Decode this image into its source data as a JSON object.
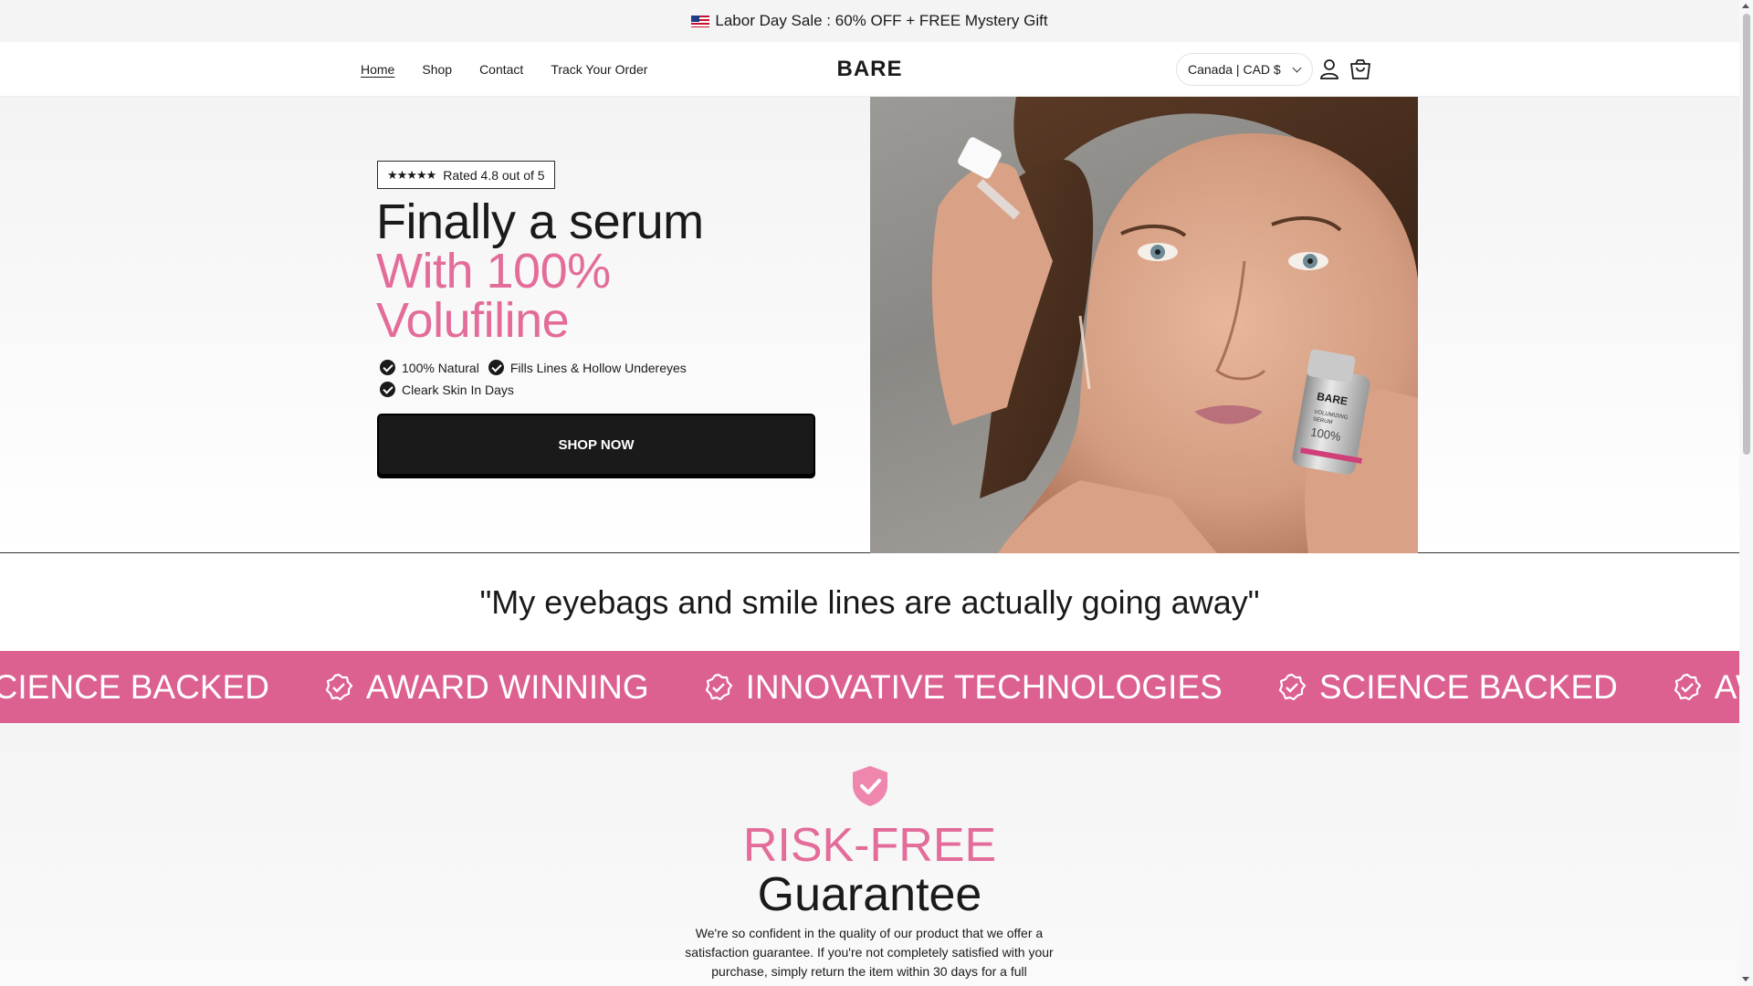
{
  "announcement": {
    "text": "Labor Day Sale : 60% OFF + FREE Mystery Gift"
  },
  "nav": {
    "items": [
      "Home",
      "Shop",
      "Contact",
      "Track Your Order"
    ],
    "active": "Home"
  },
  "brand": {
    "logo": "BARE"
  },
  "header": {
    "currency": "Canada | CAD $",
    "account_icon": "user-icon",
    "cart_icon": "cart-icon"
  },
  "hero": {
    "rating_stars": "★★★★★",
    "rating_text": "Rated 4.8 out of 5",
    "headline_line1": "Finally a serum",
    "headline_line2": "With 100%",
    "headline_line3": "Volufiline",
    "benefits": [
      "100% Natural",
      "Fills Lines & Hollow Undereyes",
      "Cleark Skin In Days"
    ],
    "cta": "SHOP NOW",
    "product_label_brand": "BARE",
    "product_label_line1": "VOLUMIZING",
    "product_label_line2": "SERUM",
    "product_label_pct": "100%",
    "image_alt": "woman-applying-serum-photo"
  },
  "quote": {
    "text": "\"My eyebags and smile lines are actually going away\""
  },
  "marquee": {
    "items": [
      "SCIENCE BACKED",
      "AWARD WINNING",
      "INNOVATIVE TECHNOLOGIES",
      "SCIENCE BACKED",
      "AWARD WINNING"
    ]
  },
  "guarantee": {
    "title_accent": "RISK-FREE",
    "title_main": "Guarantee",
    "body": "We're so confident in the quality of our product that we offer a satisfaction guarantee. If you're not completely satisfied with your purchase, simply return the item within 30 days for a full"
  },
  "colors": {
    "accent": "#dc6090",
    "headline_pink": "#e36c9a",
    "dark": "#1a1a1a"
  }
}
